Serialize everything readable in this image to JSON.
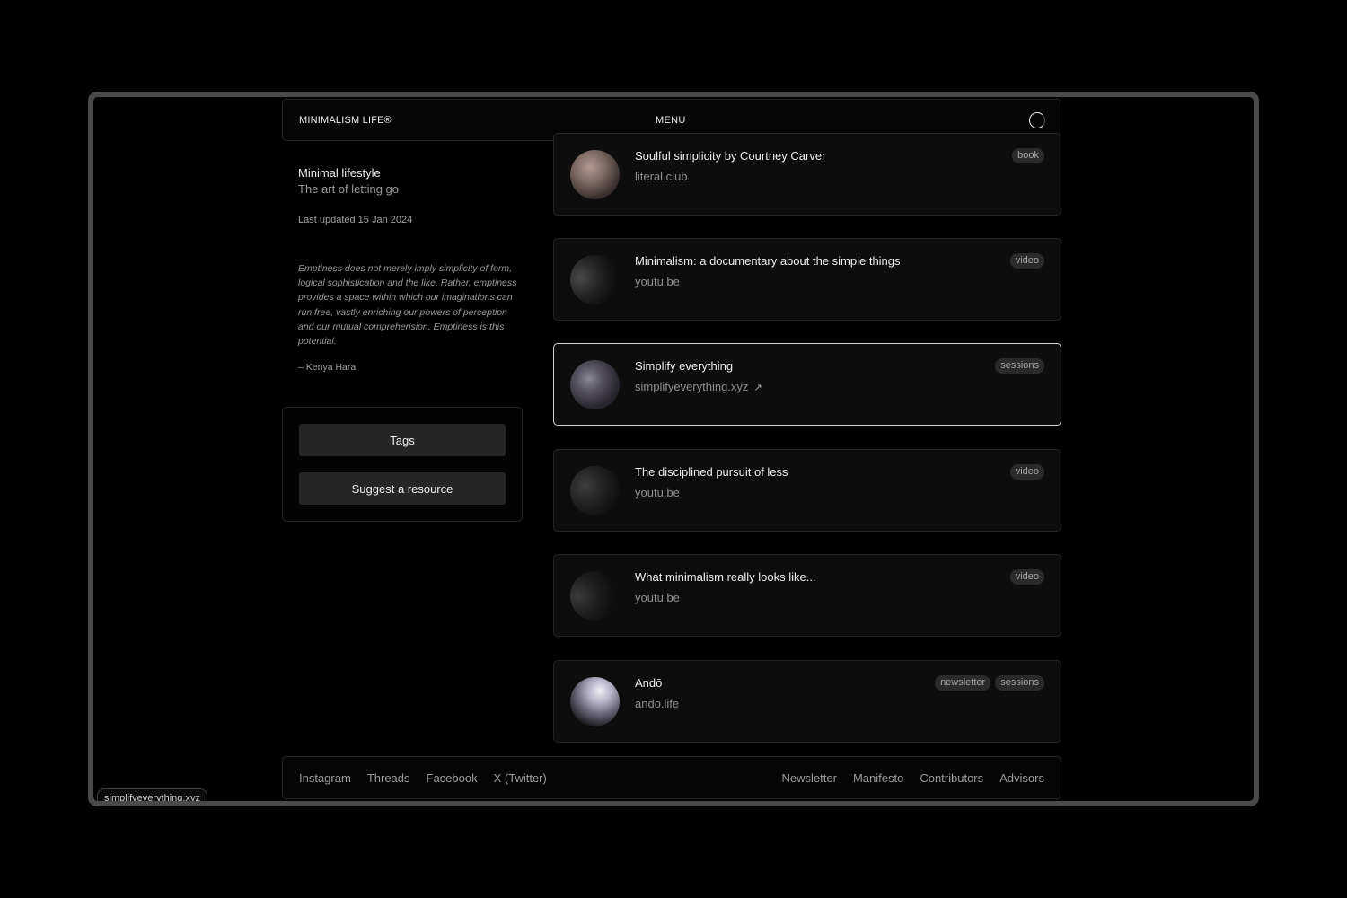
{
  "header": {
    "brand": "MINIMALISM LIFE®",
    "menu_label": "MENU",
    "loader_icon": "loader-icon"
  },
  "sidebar": {
    "title": "Minimal lifestyle",
    "subtitle": "The art of letting go",
    "updated": "Last updated 15 Jan 2024",
    "quote": "Emptiness does not merely imply simplicity of form, logical sophistication and the like. Rather, emptiness provides a space within which our imaginations can run free, vastly enriching our powers of perception and our mutual comprehension. Emptiness is this potential.",
    "quote_author": "– Kenya Hara",
    "actions": {
      "tags_label": "Tags",
      "suggest_label": "Suggest a resource"
    }
  },
  "resources": [
    {
      "title": "Soulful simplicity by Courtney Carver",
      "host": "literal.club",
      "tags": [
        "book"
      ]
    },
    {
      "title": "Minimalism: a documentary about the simple things",
      "host": "youtu.be",
      "tags": [
        "video"
      ]
    },
    {
      "title": "Simplify everything",
      "host": "simplifyeverything.xyz",
      "tags": [
        "sessions"
      ],
      "external_icon": "↗"
    },
    {
      "title": "The disciplined pursuit of less",
      "host": "youtu.be",
      "tags": [
        "video"
      ]
    },
    {
      "title": "What minimalism really looks like...",
      "host": "youtu.be",
      "tags": [
        "video"
      ]
    },
    {
      "title": "Andō",
      "host": "ando.life",
      "tags": [
        "newsletter",
        "sessions"
      ]
    }
  ],
  "footer": {
    "left": [
      "Instagram",
      "Threads",
      "Facebook",
      "X (Twitter)"
    ],
    "right": [
      "Newsletter",
      "Manifesto",
      "Contributors",
      "Advisors"
    ]
  },
  "status_url": "simplifyeverything.xyz",
  "colors": {
    "background": "#000000",
    "card": "#0d0d0d",
    "active_border": "#d4d4d4",
    "tag_bg": "#2a2a2a"
  }
}
